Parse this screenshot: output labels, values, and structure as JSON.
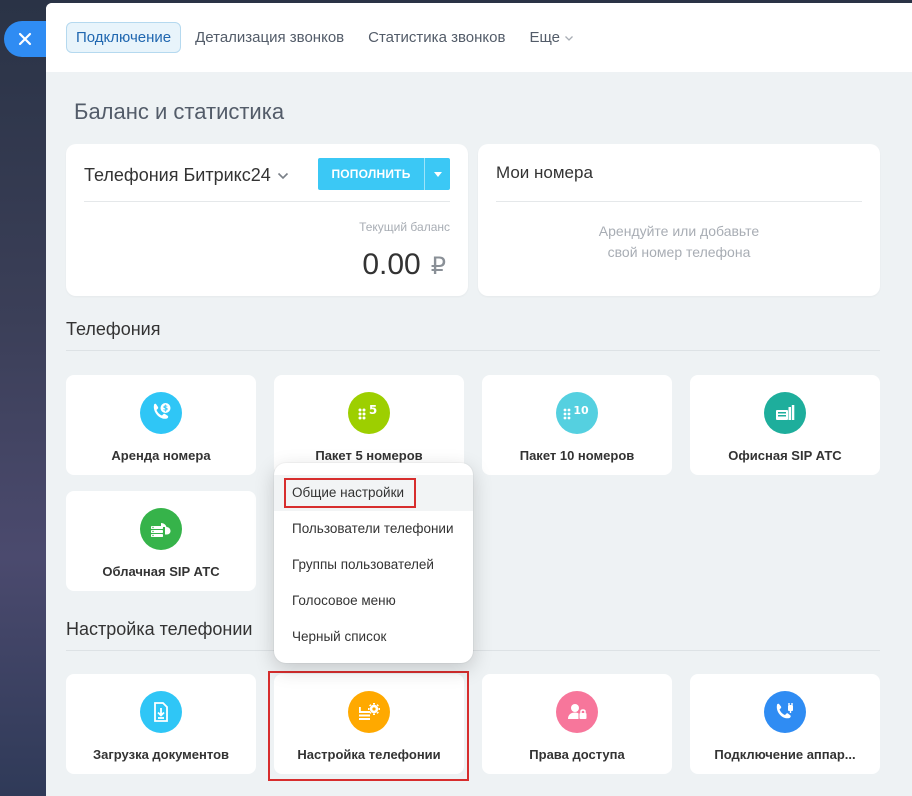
{
  "tabs": [
    {
      "label": "Подключение"
    },
    {
      "label": "Детализация звонков"
    },
    {
      "label": "Статистика звонков"
    },
    {
      "label": "Еще"
    }
  ],
  "page_title": "Баланс и статистика",
  "balance": {
    "provider": "Телефония Битрикс24",
    "topup_label": "ПОПОЛНИТЬ",
    "current_label": "Текущий баланс",
    "value": "0.00",
    "currency": "₽"
  },
  "numbers": {
    "title": "Мои номера",
    "hint_line1": "Арендуйте или добавьте",
    "hint_line2": "свой номер телефона"
  },
  "telephony": {
    "title": "Телефония",
    "tiles": [
      {
        "label": "Аренда номера",
        "icon": "phone-rent-icon",
        "color": "#2fc6f6"
      },
      {
        "label": "Пакет 5 номеров",
        "icon": "package-5-icon",
        "color": "#9dcf00",
        "badge": "5"
      },
      {
        "label": "Пакет 10 номеров",
        "icon": "package-10-icon",
        "color": "#55d0e0",
        "badge": "10"
      },
      {
        "label": "Офисная SIP АТС",
        "icon": "office-sip-icon",
        "color": "#1eae9c"
      },
      {
        "label": "Облачная SIP АТС",
        "icon": "cloud-sip-icon",
        "color": "#36b34a"
      }
    ]
  },
  "settings": {
    "title": "Настройка телефонии",
    "tiles": [
      {
        "label": "Загрузка документов",
        "icon": "document-upload-icon",
        "color": "#2fc6f6"
      },
      {
        "label": "Настройка телефонии",
        "icon": "telephony-settings-icon",
        "color": "#ffa900"
      },
      {
        "label": "Права доступа",
        "icon": "access-rights-icon",
        "color": "#f7769b"
      },
      {
        "label": "Подключение аппар...",
        "icon": "device-connect-icon",
        "color": "#2f8cf3"
      }
    ]
  },
  "menu": {
    "items": [
      {
        "label": "Общие настройки"
      },
      {
        "label": "Пользователи телефонии"
      },
      {
        "label": "Группы пользователей"
      },
      {
        "label": "Голосовое меню"
      },
      {
        "label": "Черный список"
      }
    ]
  }
}
